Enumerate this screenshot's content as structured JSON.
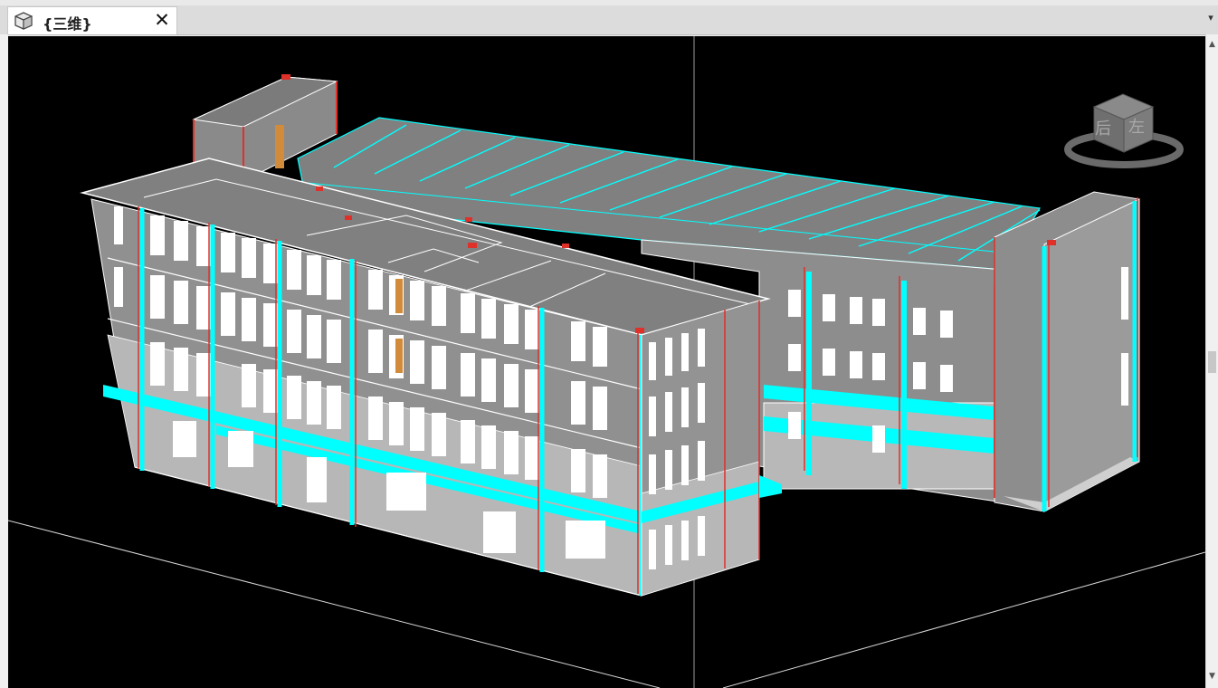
{
  "tab": {
    "title": "{三维}",
    "close_glyph": "✕",
    "icon": "3d-view-icon"
  },
  "tab_dropdown_glyph": "▾",
  "viewcube": {
    "face_left": "后",
    "face_right": "左"
  },
  "scrollbar": {
    "up_glyph": "▲",
    "down_glyph": "▼"
  },
  "colors": {
    "background": "#000000",
    "wall_gray": "#8a8a8a",
    "facade": "#9b9b9b",
    "roof": "#7d7d7d",
    "edge_white": "#ffffff",
    "accent_cyan": "#00ffff",
    "column_red": "#e0302a",
    "door_orange": "#d18b3a"
  }
}
